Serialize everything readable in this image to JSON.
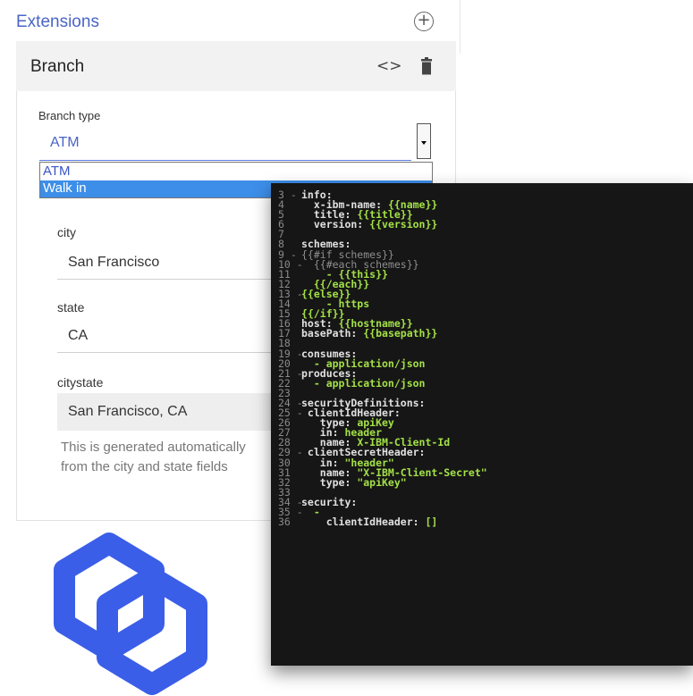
{
  "extensions": {
    "title": "Extensions",
    "add_icon": "plus-circle-icon"
  },
  "branch": {
    "title": "Branch",
    "code_label": "<>",
    "branch_type_label": "Branch type",
    "selected_value": "ATM",
    "options": [
      "ATM",
      "Walk in"
    ],
    "highlighted_option": "Walk in"
  },
  "fields": [
    {
      "label": "city",
      "value": "San Francisco"
    },
    {
      "label": "state",
      "value": "CA"
    },
    {
      "label": "citystate",
      "value": "San Francisco, CA"
    }
  ],
  "help_text": "This is generated automatically from the city and state fields",
  "code_lines": [
    {
      "n": "3",
      "f": "-",
      "parts": [
        [
          "k",
          "info:"
        ]
      ]
    },
    {
      "n": "4",
      "f": "",
      "parts": [
        [
          "k",
          "  x-ibm-name: "
        ],
        [
          "g",
          "{{name}}"
        ]
      ]
    },
    {
      "n": "5",
      "f": "",
      "parts": [
        [
          "k",
          "  title: "
        ],
        [
          "g",
          "{{title}}"
        ]
      ]
    },
    {
      "n": "6",
      "f": "",
      "parts": [
        [
          "k",
          "  version: "
        ],
        [
          "g",
          "{{version}}"
        ]
      ]
    },
    {
      "n": "7",
      "f": "",
      "parts": []
    },
    {
      "n": "8",
      "f": "",
      "parts": [
        [
          "k",
          "schemes:"
        ]
      ]
    },
    {
      "n": "9",
      "f": "-",
      "parts": [
        [
          "d",
          "{{#if schemes}}"
        ]
      ]
    },
    {
      "n": "10",
      "f": "-",
      "parts": [
        [
          "d",
          "  {{#each schemes}}"
        ]
      ]
    },
    {
      "n": "11",
      "f": "",
      "parts": [
        [
          "g",
          "    - {{this}}"
        ]
      ]
    },
    {
      "n": "12",
      "f": "",
      "parts": [
        [
          "g",
          "  {{/each}}"
        ]
      ]
    },
    {
      "n": "13",
      "f": "-",
      "parts": [
        [
          "g",
          "{{else}}"
        ]
      ]
    },
    {
      "n": "14",
      "f": "",
      "parts": [
        [
          "g",
          "    - https"
        ]
      ]
    },
    {
      "n": "15",
      "f": "",
      "parts": [
        [
          "g",
          "{{/if}}"
        ]
      ]
    },
    {
      "n": "16",
      "f": "",
      "parts": [
        [
          "k",
          "host: "
        ],
        [
          "g",
          "{{hostname}}"
        ]
      ]
    },
    {
      "n": "17",
      "f": "",
      "parts": [
        [
          "k",
          "basePath: "
        ],
        [
          "g",
          "{{basepath}}"
        ]
      ]
    },
    {
      "n": "18",
      "f": "",
      "parts": []
    },
    {
      "n": "19",
      "f": "-",
      "parts": [
        [
          "k",
          "consumes:"
        ]
      ]
    },
    {
      "n": "20",
      "f": "",
      "parts": [
        [
          "g",
          "  - application/json"
        ]
      ]
    },
    {
      "n": "21",
      "f": "-",
      "parts": [
        [
          "k",
          "produces:"
        ]
      ]
    },
    {
      "n": "22",
      "f": "",
      "parts": [
        [
          "g",
          "  - application/json"
        ]
      ]
    },
    {
      "n": "23",
      "f": "",
      "parts": []
    },
    {
      "n": "24",
      "f": "-",
      "parts": [
        [
          "k",
          "securityDefinitions:"
        ]
      ]
    },
    {
      "n": "25",
      "f": "-",
      "parts": [
        [
          "k",
          " clientIdHeader:"
        ]
      ]
    },
    {
      "n": "26",
      "f": "",
      "parts": [
        [
          "k",
          "   type: "
        ],
        [
          "g",
          "apiKey"
        ]
      ]
    },
    {
      "n": "27",
      "f": "",
      "parts": [
        [
          "k",
          "   in: "
        ],
        [
          "g",
          "header"
        ]
      ]
    },
    {
      "n": "28",
      "f": "",
      "parts": [
        [
          "k",
          "   name: "
        ],
        [
          "g",
          "X-IBM-Client-Id"
        ]
      ]
    },
    {
      "n": "29",
      "f": "-",
      "parts": [
        [
          "k",
          " clientSecretHeader:"
        ]
      ]
    },
    {
      "n": "30",
      "f": "",
      "parts": [
        [
          "k",
          "   in: "
        ],
        [
          "g",
          "\"header\""
        ]
      ]
    },
    {
      "n": "31",
      "f": "",
      "parts": [
        [
          "k",
          "   name: "
        ],
        [
          "g",
          "\"X-IBM-Client-Secret\""
        ]
      ]
    },
    {
      "n": "32",
      "f": "",
      "parts": [
        [
          "k",
          "   type: "
        ],
        [
          "g",
          "\"apiKey\""
        ]
      ]
    },
    {
      "n": "33",
      "f": "",
      "parts": []
    },
    {
      "n": "34",
      "f": "-",
      "parts": [
        [
          "k",
          "security:"
        ]
      ]
    },
    {
      "n": "35",
      "f": "-",
      "parts": [
        [
          "g",
          "  -"
        ]
      ]
    },
    {
      "n": "36",
      "f": "",
      "parts": [
        [
          "k",
          "    clientIdHeader: "
        ],
        [
          "g",
          "[]"
        ]
      ]
    }
  ],
  "colors": {
    "accent": "#4a65c6",
    "logo": "#3b5ee8",
    "editor_bg": "#161616",
    "code_green": "#a3e046"
  }
}
